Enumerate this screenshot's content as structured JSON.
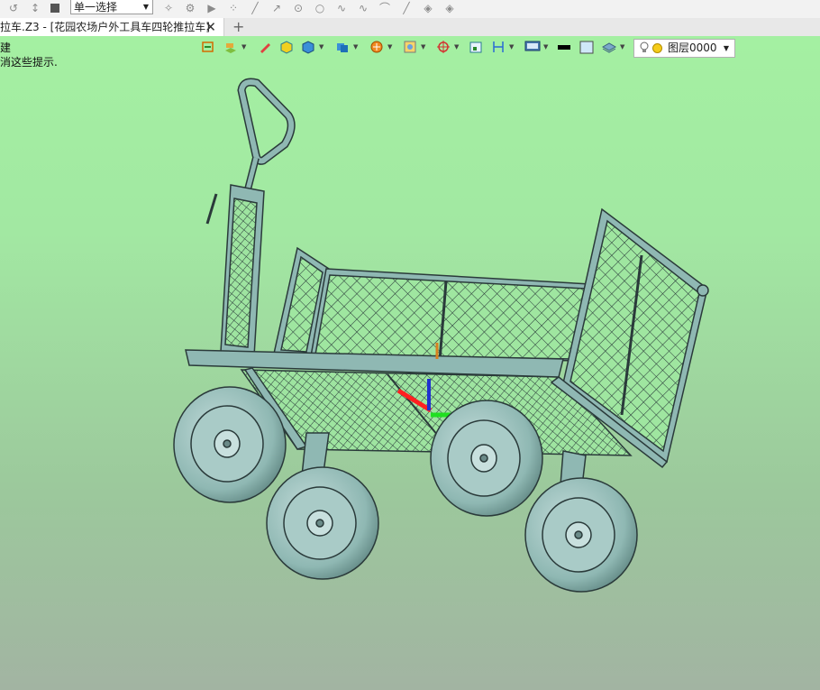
{
  "toolbar": {
    "select_mode": "单一选择",
    "icons": [
      "undo-icon",
      "redo-icon",
      "stop-icon",
      "pointer-icon",
      "filter-icon",
      "play-icon",
      "point-icon",
      "line-icon",
      "arc-icon",
      "circle-icon",
      "spline-icon",
      "curve-icon",
      "polyline-icon",
      "tangent-icon",
      "layer-stack-icon"
    ]
  },
  "tab": {
    "title": "拉车.Z3 - [花园农场户外工具车四轮推拉车]",
    "close": "✕",
    "new_tab": "+"
  },
  "hints": {
    "line1": "建",
    "line2": "消这些提示."
  },
  "view_toolbar": {
    "icons": [
      "view-orient-icon",
      "render-mode-icon",
      "sketch-pen-icon",
      "shaded-box-icon",
      "cube-view-icon",
      "blue-cube-icon",
      "section-icon",
      "frame-icon",
      "snap-icon",
      "cursor-target-icon",
      "align-icon",
      "dimension-icon",
      "display-icon",
      "color-swatch-icon",
      "fill-swatch-icon",
      "layer-manager-icon"
    ],
    "layer": {
      "name": "图层0000",
      "state": "on"
    }
  },
  "model": {
    "color": "#8fb8b3",
    "edge_color": "#2a3a3a",
    "axes": {
      "x": "#ff2020",
      "y": "#20e020",
      "z": "#2030d0"
    }
  }
}
